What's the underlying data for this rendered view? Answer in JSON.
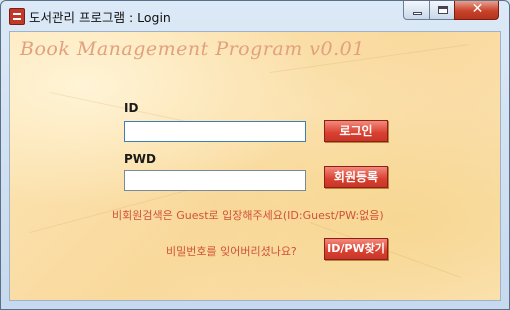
{
  "window": {
    "title": "도서관리 프로그램 : Login",
    "controls": {
      "minimize": "minimize-icon",
      "maximize": "maximize-icon",
      "close_glyph": "✕"
    }
  },
  "header": {
    "title": "Book Management Program v0.01"
  },
  "form": {
    "id_label": "ID",
    "id_value": "",
    "pwd_label": "PWD",
    "pwd_value": ""
  },
  "buttons": {
    "login": "로그인",
    "register": "회원등록",
    "find": "ID/PW찾기"
  },
  "notes": {
    "guest": "비회원검색은 Guest로 입장해주세요(ID:Guest/PW:없음)",
    "forgot": "비밀번호를 잊어버리셨나요?"
  },
  "colors": {
    "accent": "#d9402f",
    "note_text": "#d0523a",
    "title_text": "#e2a07e",
    "background": "#fbe0a9"
  }
}
